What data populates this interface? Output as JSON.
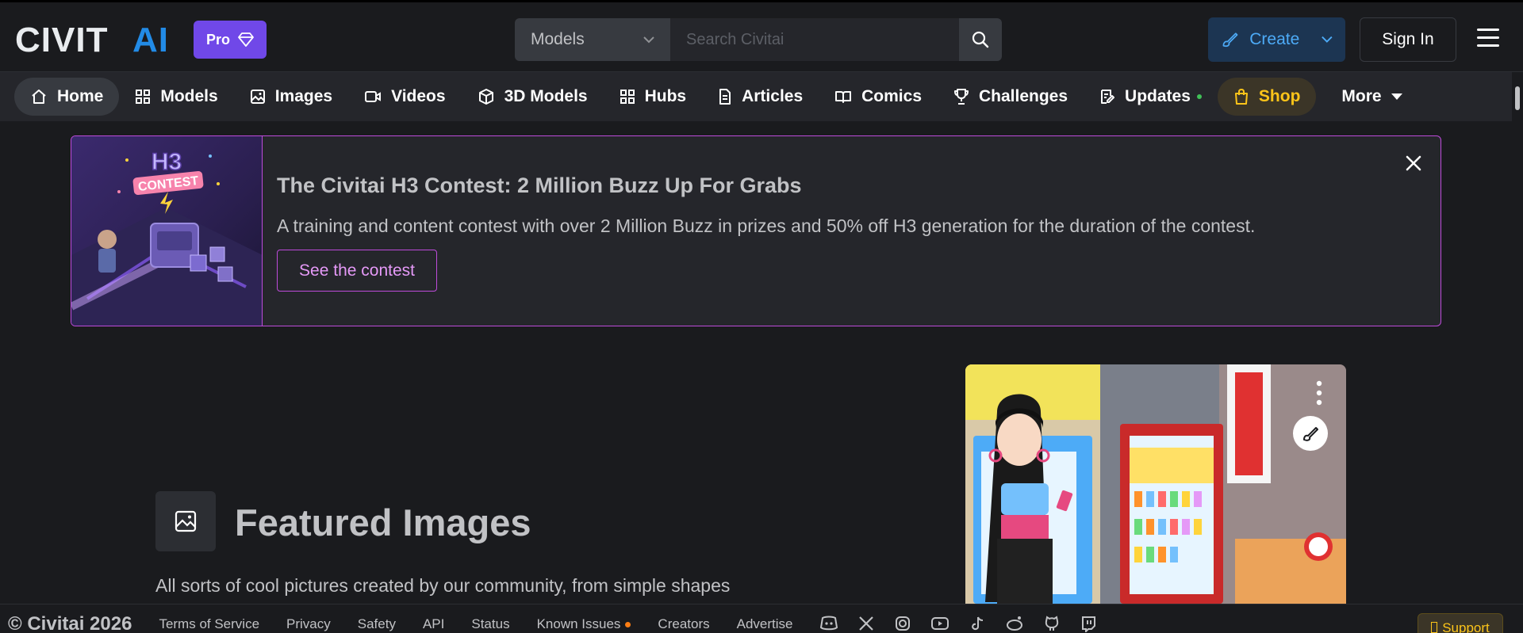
{
  "header": {
    "brand": "CIVITAI",
    "pro_label": "Pro",
    "search_category": "Models",
    "search_placeholder": "Search Civitai",
    "search_shortcut": "/",
    "create_label": "Create",
    "signin_label": "Sign In"
  },
  "nav": {
    "items": [
      {
        "label": "Home",
        "icon": "home-icon"
      },
      {
        "label": "Models",
        "icon": "grid-icon"
      },
      {
        "label": "Images",
        "icon": "image-icon"
      },
      {
        "label": "Videos",
        "icon": "video-icon"
      },
      {
        "label": "3D Models",
        "icon": "cube-icon"
      },
      {
        "label": "Hubs",
        "icon": "grid-icon"
      },
      {
        "label": "Articles",
        "icon": "document-icon"
      },
      {
        "label": "Comics",
        "icon": "book-icon"
      },
      {
        "label": "Challenges",
        "icon": "trophy-icon"
      },
      {
        "label": "Updates",
        "icon": "changelog-icon"
      },
      {
        "label": "Shop",
        "icon": "shopping-bag-icon"
      },
      {
        "label": "More",
        "icon": "caret-down-icon"
      }
    ]
  },
  "banner": {
    "image_text_1": "H3",
    "image_text_2": "CONTEST",
    "title": "The Civitai H3 Contest: 2 Million Buzz Up For Grabs",
    "description": "A training and content contest with over 2 Million Buzz in prizes and 50% off H3 generation for the duration of the contest.",
    "cta_label": "See the contest"
  },
  "featured": {
    "title": "Featured Images",
    "subtitle": "All sorts of cool pictures created by our community, from simple shapes"
  },
  "footer": {
    "copyright": "© Civitai 2026",
    "links": [
      "Terms of Service",
      "Privacy",
      "Safety",
      "API",
      "Status",
      "Known Issues",
      "Creators",
      "Advertise"
    ],
    "support_label": "Support"
  },
  "colors": {
    "pro": "#7048e8",
    "accent": "#be4bdb",
    "create_text": "#4dabf7",
    "shop": "#fcc419"
  }
}
